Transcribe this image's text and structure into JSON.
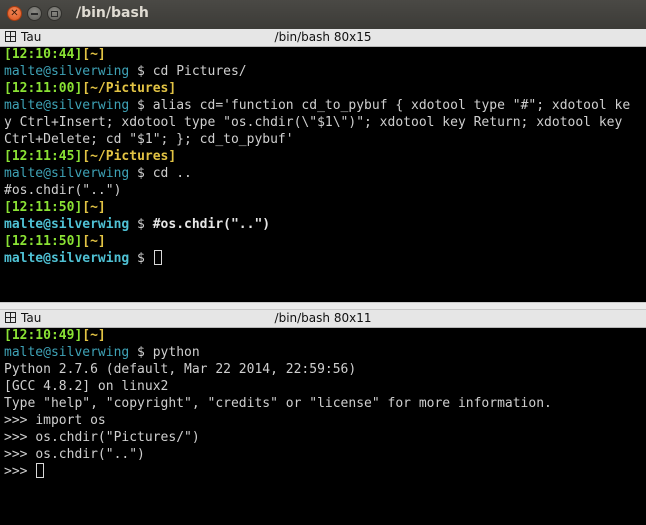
{
  "window": {
    "title": "/bin/bash"
  },
  "top_pane": {
    "label": "Tau",
    "title": "/bin/bash 80x15",
    "lines": [
      [
        "[12:10:44]",
        "[~]"
      ],
      [
        "malte@silverwing",
        " $ ",
        "cd Pictures/"
      ],
      [
        "[12:11:00]",
        "[~/Pictures]"
      ],
      [
        "malte@silverwing",
        " $ ",
        "alias cd='function cd_to_pybuf { xdotool type \"#\"; xdotool ke"
      ],
      [
        "y Ctrl+Insert; xdotool type \"os.chdir(\\\"$1\\\")\"; xdotool key Return; xdotool key"
      ],
      [
        "Ctrl+Delete; cd \"$1\"; }; cd_to_pybuf'"
      ],
      [
        "[12:11:45]",
        "[~/Pictures]"
      ],
      [
        "malte@silverwing",
        " $ ",
        "cd .."
      ],
      [
        "#os.chdir(\"..\")"
      ],
      [
        "[12:11:50]",
        "[~]"
      ],
      [
        "malte@silverwing",
        " $ ",
        "#os.chdir(\"..\")"
      ],
      [
        "[12:11:50]",
        "[~]"
      ],
      [
        "malte@silverwing",
        " $ ",
        ""
      ]
    ]
  },
  "bottom_pane": {
    "label": "Tau",
    "title": "/bin/bash 80x11",
    "lines": [
      [
        "[12:10:49]",
        "[~]"
      ],
      [
        "malte@silverwing",
        " $ ",
        "python"
      ],
      [
        "Python 2.7.6 (default, Mar 22 2014, 22:59:56)"
      ],
      [
        "[GCC 4.8.2] on linux2"
      ],
      [
        "Type \"help\", \"copyright\", \"credits\" or \"license\" for more information."
      ],
      [
        ">>> ",
        "import os"
      ],
      [
        ">>> ",
        "os.chdir(\"Pictures/\")"
      ],
      [
        ">>> ",
        "os.chdir(\"..\")"
      ],
      [
        ">>> ",
        ""
      ]
    ]
  },
  "colors": {
    "time": "#8ae234",
    "path": "#e2c344",
    "user": "#3ea2b6",
    "text": "#cfcfcf"
  }
}
